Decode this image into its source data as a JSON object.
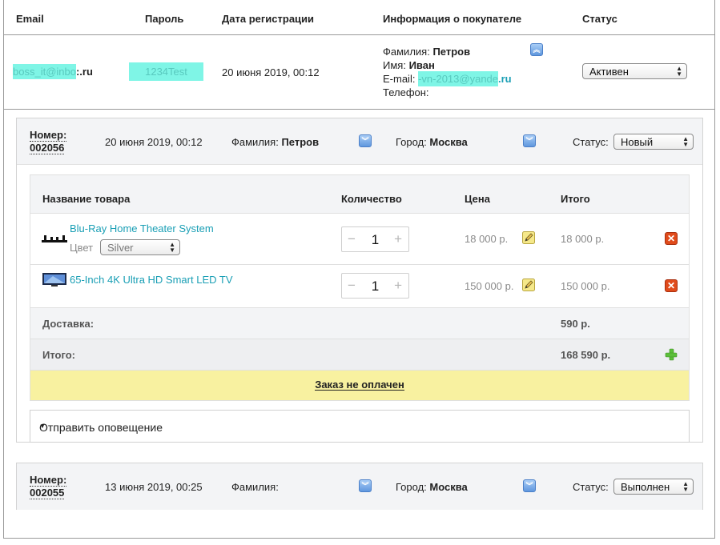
{
  "header": {
    "email": "Email",
    "password": "Пароль",
    "reg_date": "Дата регистрации",
    "customer_info": "Информация о покупателе",
    "status": "Статус"
  },
  "user": {
    "email_masked": "boss_it@inbo",
    "email_suffix": ":.ru",
    "password": "1234Test",
    "reg_date": "20 июня 2019, 00:12",
    "surname_label": "Фамилия:",
    "surname": "Петров",
    "name_label": "Имя:",
    "name": "Иван",
    "email_label": "E-mail:",
    "contact_email_masked": "-vn-2013@yande",
    "contact_email_suffix": ".ru",
    "phone_label": "Телефон:",
    "status": "Активен"
  },
  "orders": [
    {
      "number_label": "Номер:",
      "number": "002056",
      "date": "20 июня 2019, 00:12",
      "surname_label": "Фамилия:",
      "surname": "Петров",
      "city_label": "Город:",
      "city": "Москва",
      "status_label": "Статус:",
      "status": "Новый",
      "table_headers": {
        "name": "Название товара",
        "qty": "Количество",
        "price": "Цена",
        "total": "Итого"
      },
      "items": [
        {
          "name": "Blu-Ray Home Theater System",
          "color_label": "Цвет",
          "color": "Silver",
          "qty": "1",
          "price": "18 000 р.",
          "total": "18 000 р."
        },
        {
          "name": "65-Inch 4K Ultra HD Smart LED TV",
          "qty": "1",
          "price": "150 000 р.",
          "total": "150 000 р."
        }
      ],
      "delivery_label": "Доставка:",
      "delivery_value": "590 р.",
      "total_label": "Итого:",
      "total_value": "168 590 р.",
      "payment_status": "Заказ не оплачен",
      "notify_label": "Отправить оповещение"
    },
    {
      "number_label": "Номер:",
      "number": "002055",
      "date": "13 июня 2019, 00:25",
      "surname_label": "Фамилия:",
      "surname": "",
      "city_label": "Город:",
      "city": "Москва",
      "status_label": "Статус:",
      "status": "Выполнен"
    }
  ],
  "colors": {
    "accent_link": "#1a9fb5",
    "highlight": "#7ff5e6",
    "unpaid_bg": "#f8f1a0",
    "delete": "#e04b1b"
  }
}
